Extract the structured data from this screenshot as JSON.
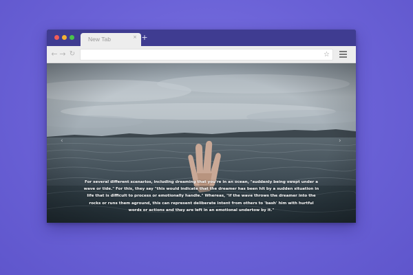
{
  "browser": {
    "tab": {
      "label": "New Tab",
      "close_glyph": "×"
    },
    "new_tab_glyph": "+",
    "toolbar": {
      "back_glyph": "←",
      "forward_glyph": "→",
      "reload_glyph": "↻",
      "address_value": "",
      "bookmark_glyph": "☆"
    }
  },
  "slide": {
    "prev_glyph": "‹",
    "next_glyph": "›",
    "caption": "For several different scenarios, including dreaming that you're in an ocean, \"suddenly being swept under a wave or tide.\" For this, they say \"this would indicate that the dreamer has been hit by a sudden situation in life that is difficult to process or emotionally handle.\" Whereas, \"if the wave throws the dreamer into the rocks or runs them aground, this can represent deliberate intent from others to 'bash' him with hurtful words or actions and they are left in an emotional undertow by it.\""
  },
  "colors": {
    "desktop": "#6d64d8",
    "titlebar": "#3f3c91",
    "close": "#f25d58",
    "minimize": "#f5b234",
    "maximize": "#4ac44b"
  }
}
